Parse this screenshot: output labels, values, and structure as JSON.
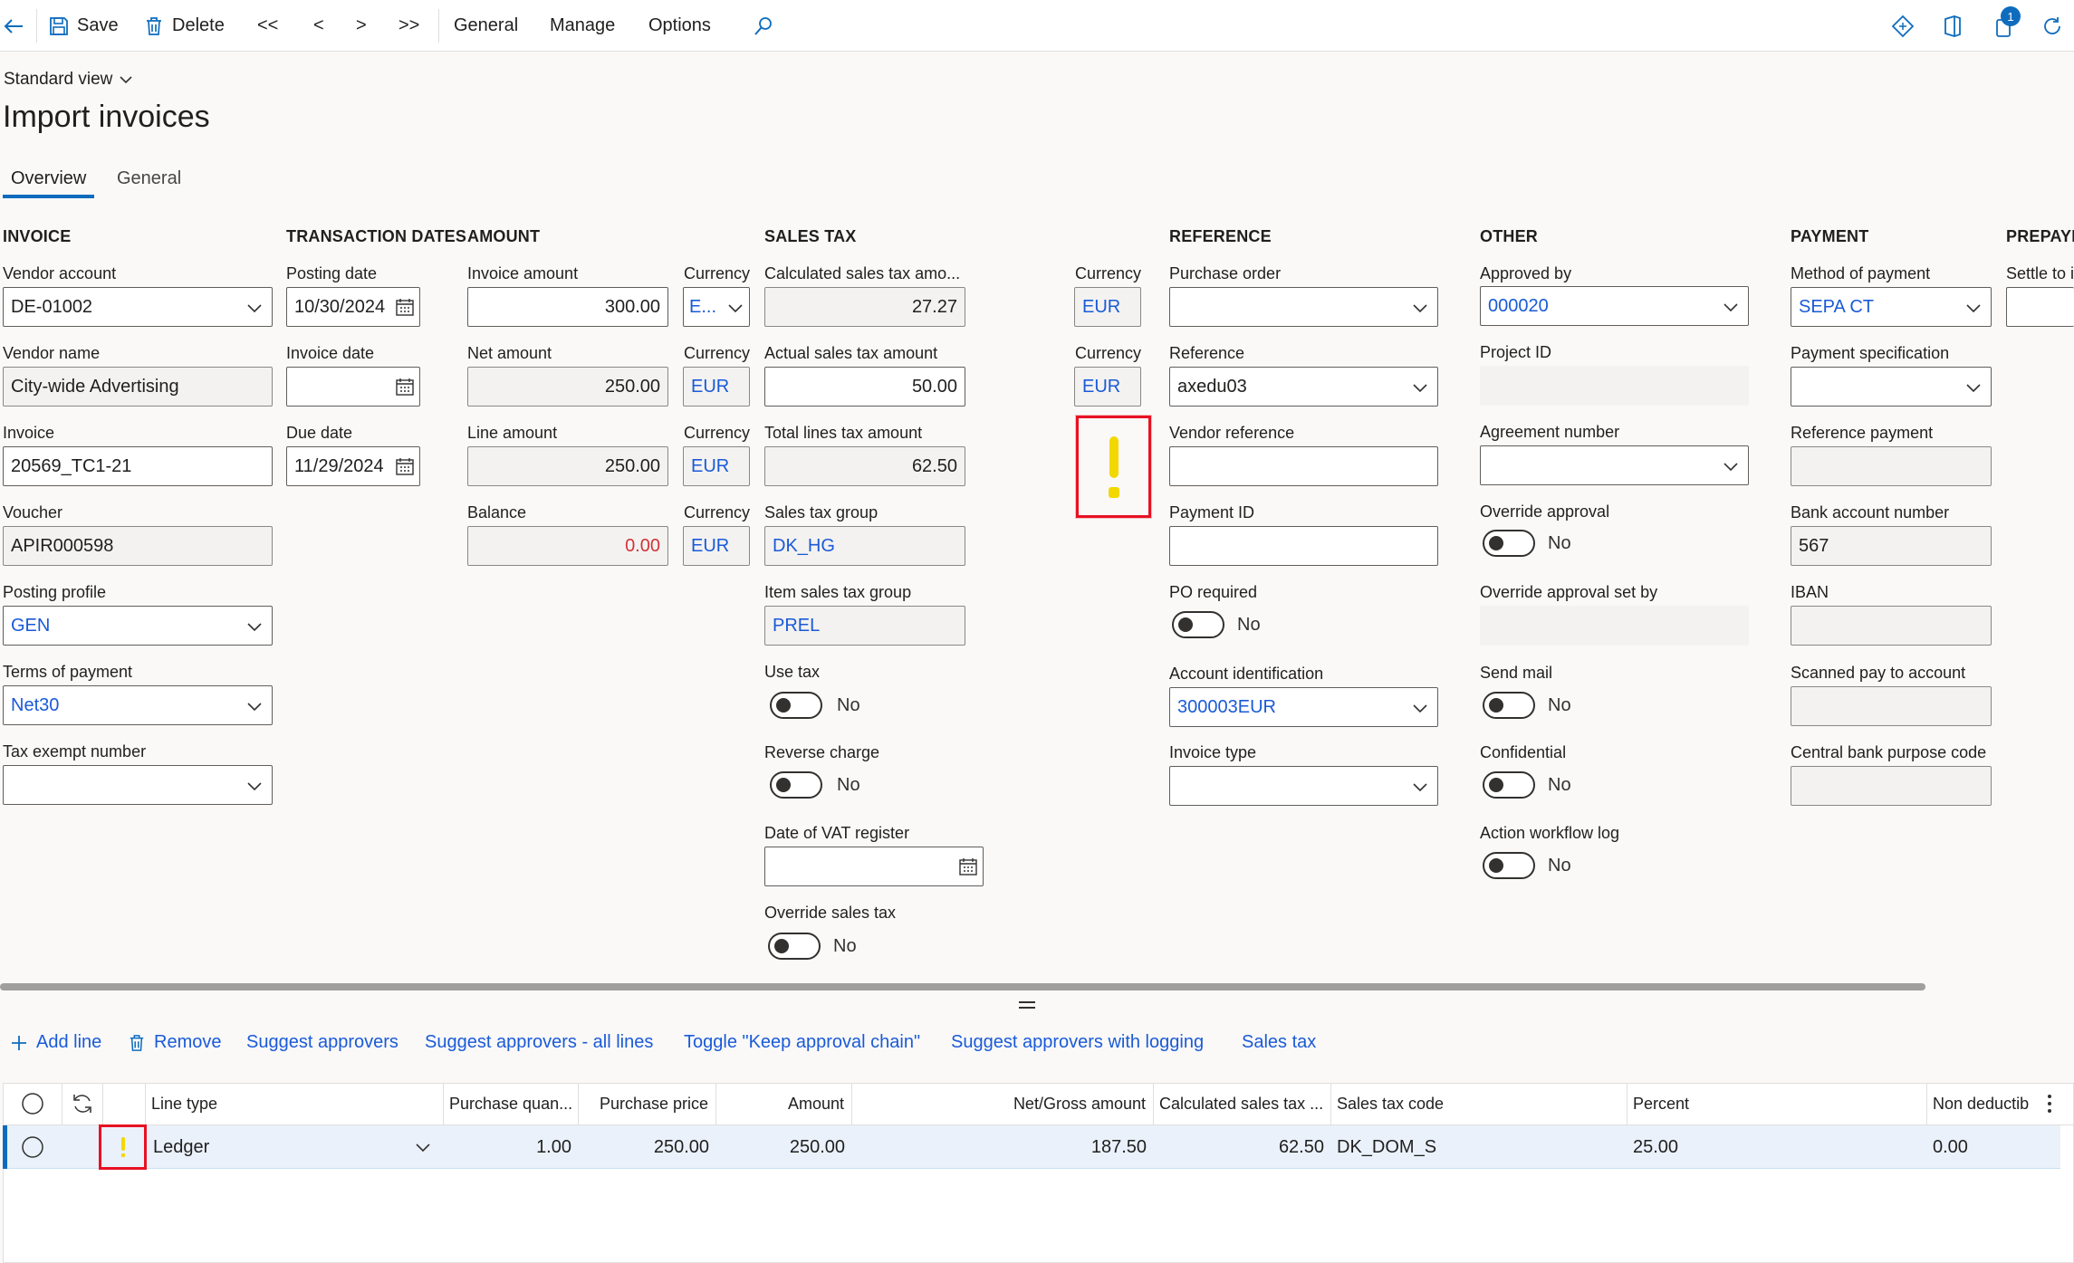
{
  "toolbar": {
    "save": "Save",
    "delete": "Delete",
    "first": "<<",
    "prev": "<",
    "next": ">",
    "last": ">>",
    "general": "General",
    "manage": "Manage",
    "options": "Options",
    "badge": "1"
  },
  "page": {
    "view": "Standard view",
    "title": "Import invoices",
    "tabs": [
      "Overview",
      "General"
    ]
  },
  "sections": {
    "invoice": "INVOICE",
    "transaction_dates": "TRANSACTION DATES",
    "amount": "AMOUNT",
    "sales_tax": "SALES TAX",
    "reference": "REFERENCE",
    "other": "OTHER",
    "payment": "PAYMENT",
    "prepayment": "PREPAYM"
  },
  "invoice": {
    "vendor_account_label": "Vendor account",
    "vendor_account": "DE-01002",
    "vendor_name_label": "Vendor name",
    "vendor_name": "City-wide Advertising",
    "invoice_label": "Invoice",
    "invoice": "20569_TC1-21",
    "voucher_label": "Voucher",
    "voucher": "APIR000598",
    "posting_profile_label": "Posting profile",
    "posting_profile": "GEN",
    "terms_label": "Terms of payment",
    "terms": "Net30",
    "tax_exempt_label": "Tax exempt number",
    "tax_exempt": ""
  },
  "dates": {
    "posting_date_label": "Posting date",
    "posting_date": "10/30/2024",
    "invoice_date_label": "Invoice date",
    "invoice_date": "",
    "due_date_label": "Due date",
    "due_date": "11/29/2024"
  },
  "amount": {
    "invoice_amount_label": "Invoice amount",
    "invoice_amount": "300.00",
    "net_amount_label": "Net amount",
    "net_amount": "250.00",
    "line_amount_label": "Line amount",
    "line_amount": "250.00",
    "balance_label": "Balance",
    "balance": "0.00",
    "currency_label": "Currency",
    "currency_1": "E...",
    "currency_2": "EUR",
    "currency_3": "EUR",
    "currency_4": "EUR"
  },
  "sales_tax": {
    "calc_label": "Calculated sales tax amo...",
    "calc": "27.27",
    "actual_label": "Actual sales tax amount",
    "actual": "50.00",
    "total_lines_label": "Total lines tax amount",
    "total_lines": "62.50",
    "group_label": "Sales tax group",
    "group": "DK_HG",
    "item_group_label": "Item sales tax group",
    "item_group": "PREL",
    "use_tax_label": "Use tax",
    "use_tax": "No",
    "reverse_charge_label": "Reverse charge",
    "reverse_charge": "No",
    "vat_date_label": "Date of VAT register",
    "vat_date": "",
    "override_label": "Override sales tax",
    "override": "No",
    "currency_label": "Currency",
    "currency_1": "EUR",
    "currency_2": "EUR",
    "warning": "!"
  },
  "reference": {
    "po_label": "Purchase order",
    "po": "",
    "ref_label": "Reference",
    "ref": "axedu03",
    "vendor_ref_label": "Vendor reference",
    "vendor_ref": "",
    "payment_id_label": "Payment ID",
    "payment_id": "",
    "po_required_label": "PO required",
    "po_required": "No",
    "account_id_label": "Account identification",
    "account_id": "300003EUR",
    "invoice_type_label": "Invoice type",
    "invoice_type": ""
  },
  "other": {
    "approved_by_label": "Approved by",
    "approved_by": "000020",
    "project_label": "Project ID",
    "agreement_label": "Agreement number",
    "override_approval_label": "Override approval",
    "override_approval": "No",
    "override_set_by_label": "Override approval set by",
    "send_mail_label": "Send mail",
    "send_mail": "No",
    "confidential_label": "Confidential",
    "confidential": "No",
    "workflow_log_label": "Action workflow log",
    "workflow_log": "No"
  },
  "payment": {
    "method_label": "Method of payment",
    "method": "SEPA CT",
    "spec_label": "Payment specification",
    "ref_payment_label": "Reference payment",
    "bank_label": "Bank account number",
    "bank": "567",
    "iban_label": "IBAN",
    "scanned_label": "Scanned pay to account",
    "central_label": "Central bank purpose code",
    "settle_label": "Settle to i"
  },
  "actions": {
    "add_line": "Add line",
    "remove": "Remove",
    "suggest": "Suggest approvers",
    "suggest_all": "Suggest approvers - all lines",
    "toggle_keep": "Toggle \"Keep approval chain\"",
    "suggest_log": "Suggest approvers with logging",
    "sales_tax": "Sales tax"
  },
  "grid": {
    "headers": [
      "Line type",
      "Purchase quan...",
      "Purchase price",
      "Amount",
      "Net/Gross amount",
      "Calculated sales tax ...",
      "Sales tax code",
      "Percent",
      "Non deductib"
    ],
    "row": {
      "line_type": "Ledger",
      "qty": "1.00",
      "price": "250.00",
      "amount": "250.00",
      "net_gross": "187.50",
      "calc_tax": "62.50",
      "tax_code": "DK_DOM_S",
      "percent": "25.00",
      "non_deduct": "0.00",
      "warning": "!"
    }
  },
  "colors": {
    "accent": "#0f6cbd",
    "link": "#1a5ad8",
    "warning": "#f2d800",
    "highlight": "#e81123",
    "selected_row": "#eaf1fb"
  }
}
